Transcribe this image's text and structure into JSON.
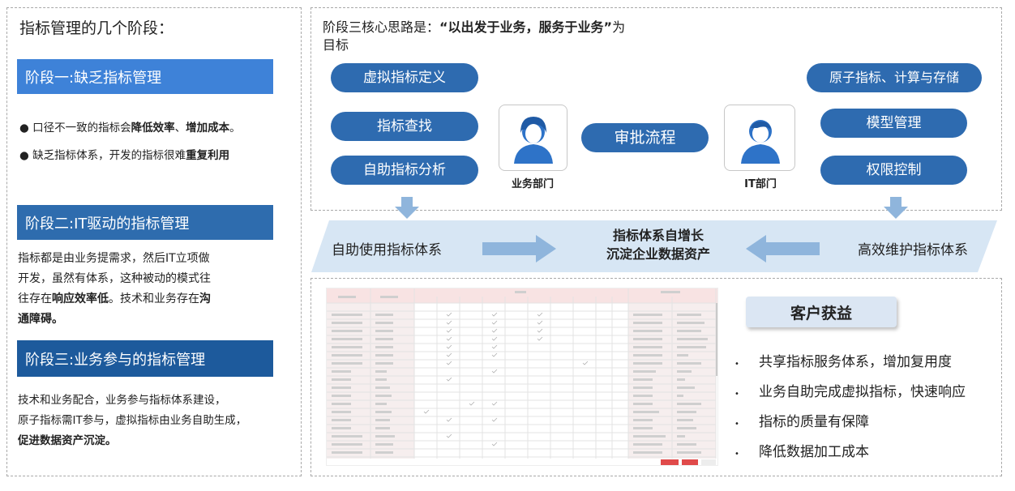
{
  "left": {
    "heading": "指标管理的几个阶段：",
    "stage1": {
      "title": "阶段一:缺乏指标管理",
      "b1": {
        "t1": "口径不一致的指标会",
        "t2": "降低效率",
        "t3": "、",
        "t4": "增加成本",
        "t5": "。"
      },
      "b2": {
        "t1": "缺乏指标体系，开发的指标很难",
        "t2": "重复利用"
      }
    },
    "stage2": {
      "title": "阶段二:IT驱动的指标管理",
      "l1": "指标都是由业务提需求，然后IT立项做",
      "l2": "开发，虽然有体系，这种被动的模式往",
      "l3a": "往存在",
      "l3b": "响应效率低",
      "l3c": "。技术和业务存在",
      "l3d": "沟",
      "l4": "通障碍。"
    },
    "stage3": {
      "title": "阶段三:业务参与的指标管理",
      "l1": "技术和业务配合，业务参与指标体系建设，",
      "l2": "原子指标需IT参与，虚拟指标由业务自助生成，",
      "l3": "促进数据资产沉淀。"
    }
  },
  "top": {
    "heading_a": "阶段三核心思路是：",
    "heading_b": "“以出发于业务，服务于业务”",
    "heading_c": "为",
    "heading_d": "目标",
    "left_pills": [
      "虚拟指标定义",
      "指标查找",
      "自助指标分析"
    ],
    "center_pill": "审批流程",
    "right_pills": [
      "原子指标、计算与存储",
      "模型管理",
      "权限控制"
    ],
    "business_label": "业务部门",
    "it_label": "IT部门"
  },
  "band": {
    "left": "自助使用指标体系",
    "center1": "指标体系自增长",
    "center2": "沉淀企业数据资产",
    "right": "高效维护指标体系"
  },
  "bottom": {
    "benefit_title": "客户获益",
    "benefits": [
      "共享指标服务体系，增加复用度",
      "业务自助完成虚拟指标，快速响应",
      "指标的质量有保障",
      "降低数据加工成本"
    ]
  },
  "colors": {
    "stage1": "#3e82d8",
    "stage2": "#2e6cae",
    "stage3": "#1d5a9c",
    "pill": "#2e6bb0",
    "band": "#d7e6f4",
    "arrow": "#8fb5dc"
  }
}
